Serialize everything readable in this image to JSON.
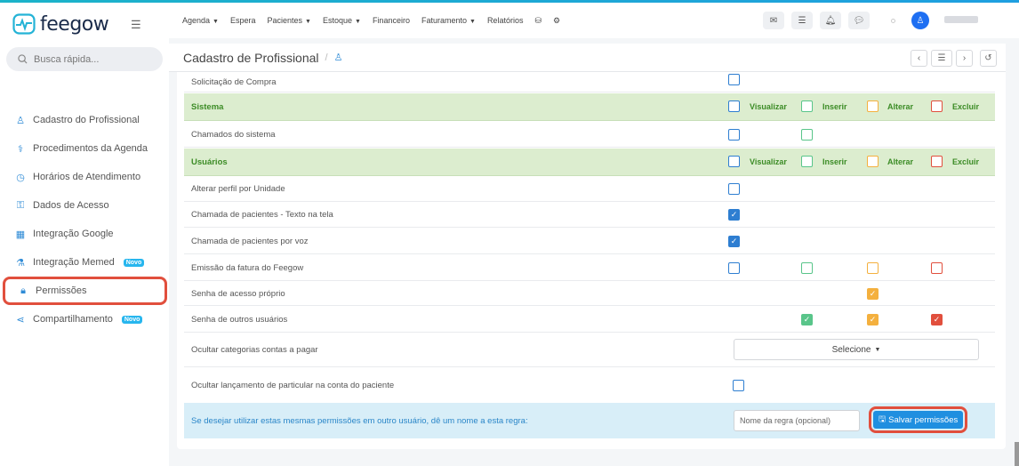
{
  "app": {
    "logo_text": "feegow"
  },
  "search": {
    "placeholder": "Busca rápida..."
  },
  "topnav": [
    {
      "label": "Agenda",
      "caret": true
    },
    {
      "label": "Espera",
      "caret": false
    },
    {
      "label": "Pacientes",
      "caret": true
    },
    {
      "label": "Estoque",
      "caret": true
    },
    {
      "label": "Financeiro",
      "caret": false
    },
    {
      "label": "Faturamento",
      "caret": true
    },
    {
      "label": "Relatórios",
      "caret": false
    }
  ],
  "header": {
    "title": "Cadastro de Profissional"
  },
  "sidebar": {
    "items": [
      {
        "label": "Cadastro do Profissional",
        "icon": "user-icon"
      },
      {
        "label": "Procedimentos da Agenda",
        "icon": "stethoscope-icon"
      },
      {
        "label": "Horários de Atendimento",
        "icon": "clock-icon"
      },
      {
        "label": "Dados de Acesso",
        "icon": "key-icon"
      },
      {
        "label": "Integração Google",
        "icon": "calendar-icon"
      },
      {
        "label": "Integração Memed",
        "icon": "flask-icon",
        "badge": "Novo"
      },
      {
        "label": "Permissões",
        "icon": "lock-icon",
        "active": true
      },
      {
        "label": "Compartilhamento",
        "icon": "share-icon",
        "badge": "Novo"
      }
    ]
  },
  "permissions": {
    "col_labels": {
      "view": "Visualizar",
      "insert": "Inserir",
      "edit": "Alterar",
      "delete": "Excluir"
    },
    "rows": [
      {
        "label": "Solicitação de Compra"
      },
      {
        "label": "Sistema",
        "group": true
      },
      {
        "label": "Chamados do sistema"
      },
      {
        "label": "Usuários",
        "group": true
      },
      {
        "label": "Alterar perfil por Unidade"
      },
      {
        "label": "Chamada de pacientes - Texto na tela"
      },
      {
        "label": "Chamada de pacientes por voz"
      },
      {
        "label": "Emissão da fatura do Feegow"
      },
      {
        "label": "Senha de acesso próprio"
      },
      {
        "label": "Senha de outros usuários"
      },
      {
        "label": "Ocultar categorias contas a pagar"
      },
      {
        "label": "Ocultar lançamento de particular na conta do paciente"
      }
    ],
    "select_value": "Selecione",
    "footer_text": "Se desejar utilizar estas mesmas permissões em outro usuário, dê um nome a esta regra:",
    "rule_placeholder": "Nome da regra (opcional)",
    "save_label": "Salvar permissões"
  },
  "colors": {
    "accent": "#1f8fe0",
    "group_bg": "#dcedcf",
    "group_text": "#3c8c26",
    "highlight": "#e14f3d"
  }
}
